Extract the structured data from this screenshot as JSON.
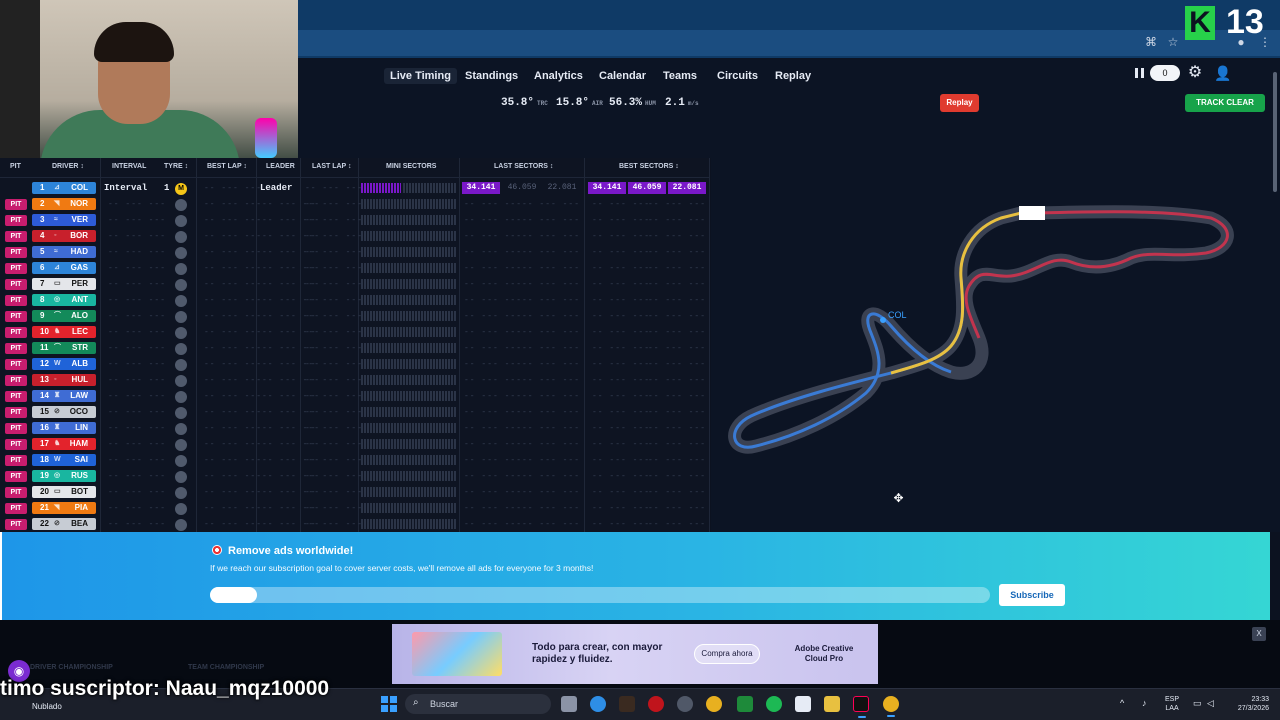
{
  "stream": {
    "counter_value": "13",
    "subscriber_overlay": "timo suscriptor: Naau_mqz10000"
  },
  "nav": {
    "links": [
      "Live Timing",
      "Standings",
      "Analytics",
      "Calendar",
      "Teams",
      "Circuits",
      "Replay"
    ],
    "active": "Live Timing",
    "weather": [
      {
        "value": "35.8°",
        "unit": "TRC"
      },
      {
        "value": "15.8°",
        "unit": "AIR"
      },
      {
        "value": "56.3%",
        "unit": "HUM"
      },
      {
        "value": "2.1",
        "unit": "m/s"
      }
    ],
    "replay_button": "Replay",
    "track_status": "TRACK CLEAR",
    "delay_value": "0"
  },
  "table": {
    "headers": {
      "pit": "PIT",
      "driver": "DRIVER ↕",
      "interval": "INTERVAL",
      "tyre": "TYRE ↕",
      "best_lap": "BEST LAP ↕",
      "leader": "LEADER",
      "last_lap": "LAST LAP ↕",
      "mini_sectors": "MINI SECTORS",
      "last_sectors": "LAST SECTORS ↕",
      "best_sectors": "BEST SECTORS ↕"
    },
    "placeholder": "-- --- ---",
    "leader_row": {
      "interval": "Interval",
      "laps": "1",
      "tyre": "M",
      "leader": "Leader",
      "last_sectors": [
        "34.141",
        "46.059",
        "22.081"
      ],
      "best_sectors": [
        "34.141",
        "46.059",
        "22.081"
      ]
    },
    "rows": [
      {
        "pos": "1",
        "code": "COL",
        "logo": "⊿",
        "color": "#2d84d8",
        "pit": ""
      },
      {
        "pos": "2",
        "code": "NOR",
        "logo": "◥",
        "color": "#f07a12",
        "pit": "PIT"
      },
      {
        "pos": "3",
        "code": "VER",
        "logo": "≈",
        "color": "#2d5bd8",
        "pit": "PIT"
      },
      {
        "pos": "4",
        "code": "BOR",
        "logo": "◦",
        "color": "#c8202c",
        "pit": "PIT"
      },
      {
        "pos": "5",
        "code": "HAD",
        "logo": "≈",
        "color": "#3f6cd4",
        "pit": "PIT"
      },
      {
        "pos": "6",
        "code": "GAS",
        "logo": "⊿",
        "color": "#2d84d8",
        "pit": "PIT"
      },
      {
        "pos": "7",
        "code": "PER",
        "logo": "▭",
        "color": "#e4e6ea",
        "pit": "PIT"
      },
      {
        "pos": "8",
        "code": "ANT",
        "logo": "◎",
        "color": "#19b6a0",
        "pit": "PIT"
      },
      {
        "pos": "9",
        "code": "ALO",
        "logo": "⌒",
        "color": "#138a5a",
        "pit": "PIT"
      },
      {
        "pos": "10",
        "code": "LEC",
        "logo": "♞",
        "color": "#e3232c",
        "pit": "PIT"
      },
      {
        "pos": "11",
        "code": "STR",
        "logo": "⌒",
        "color": "#138a5a",
        "pit": "PIT"
      },
      {
        "pos": "12",
        "code": "ALB",
        "logo": "W",
        "color": "#1f63d8",
        "pit": "PIT"
      },
      {
        "pos": "13",
        "code": "HUL",
        "logo": "◦",
        "color": "#c8202c",
        "pit": "PIT"
      },
      {
        "pos": "14",
        "code": "LAW",
        "logo": "♜",
        "color": "#3f6cd4",
        "pit": "PIT"
      },
      {
        "pos": "15",
        "code": "OCO",
        "logo": "⊘",
        "color": "#c7ccd4",
        "pit": "PIT"
      },
      {
        "pos": "16",
        "code": "LIN",
        "logo": "♜",
        "color": "#3f6cd4",
        "pit": "PIT"
      },
      {
        "pos": "17",
        "code": "HAM",
        "logo": "♞",
        "color": "#e3232c",
        "pit": "PIT"
      },
      {
        "pos": "18",
        "code": "SAI",
        "logo": "W",
        "color": "#1f63d8",
        "pit": "PIT"
      },
      {
        "pos": "19",
        "code": "RUS",
        "logo": "◎",
        "color": "#19b6a0",
        "pit": "PIT"
      },
      {
        "pos": "20",
        "code": "BOT",
        "logo": "▭",
        "color": "#e4e6ea",
        "pit": "PIT"
      },
      {
        "pos": "21",
        "code": "PIA",
        "logo": "◥",
        "color": "#f07a12",
        "pit": "PIT"
      },
      {
        "pos": "22",
        "code": "BEA",
        "logo": "⊘",
        "color": "#c7ccd4",
        "pit": "PIT"
      }
    ]
  },
  "track": {
    "car_label": "COL",
    "car_color": "#3aa0ff",
    "sector_colors": {
      "s1": "#e8c040",
      "s2": "#c2344e",
      "s3": "#3a7bd5"
    }
  },
  "banner": {
    "title": "Remove ads worldwide!",
    "description": "If we reach our subscription goal to cover server costs, we'll remove all ads for everyone for 3 months!",
    "progress": 0.06,
    "button": "Subscribe"
  },
  "footer": {
    "tabs": [
      "DRIVER CHAMPIONSHIP",
      "TEAM CHAMPIONSHIP"
    ]
  },
  "ad": {
    "headline": "Todo para crear, con mayor rapidez y fluidez.",
    "cta": "Compra ahora",
    "brand": "Adobe Creative Cloud Pro",
    "close": "X"
  },
  "taskbar": {
    "weather": "Nublado",
    "search_placeholder": "Buscar",
    "language": "ESP",
    "layout": "LAA",
    "time": "23:33",
    "date": "27/3/2026"
  }
}
